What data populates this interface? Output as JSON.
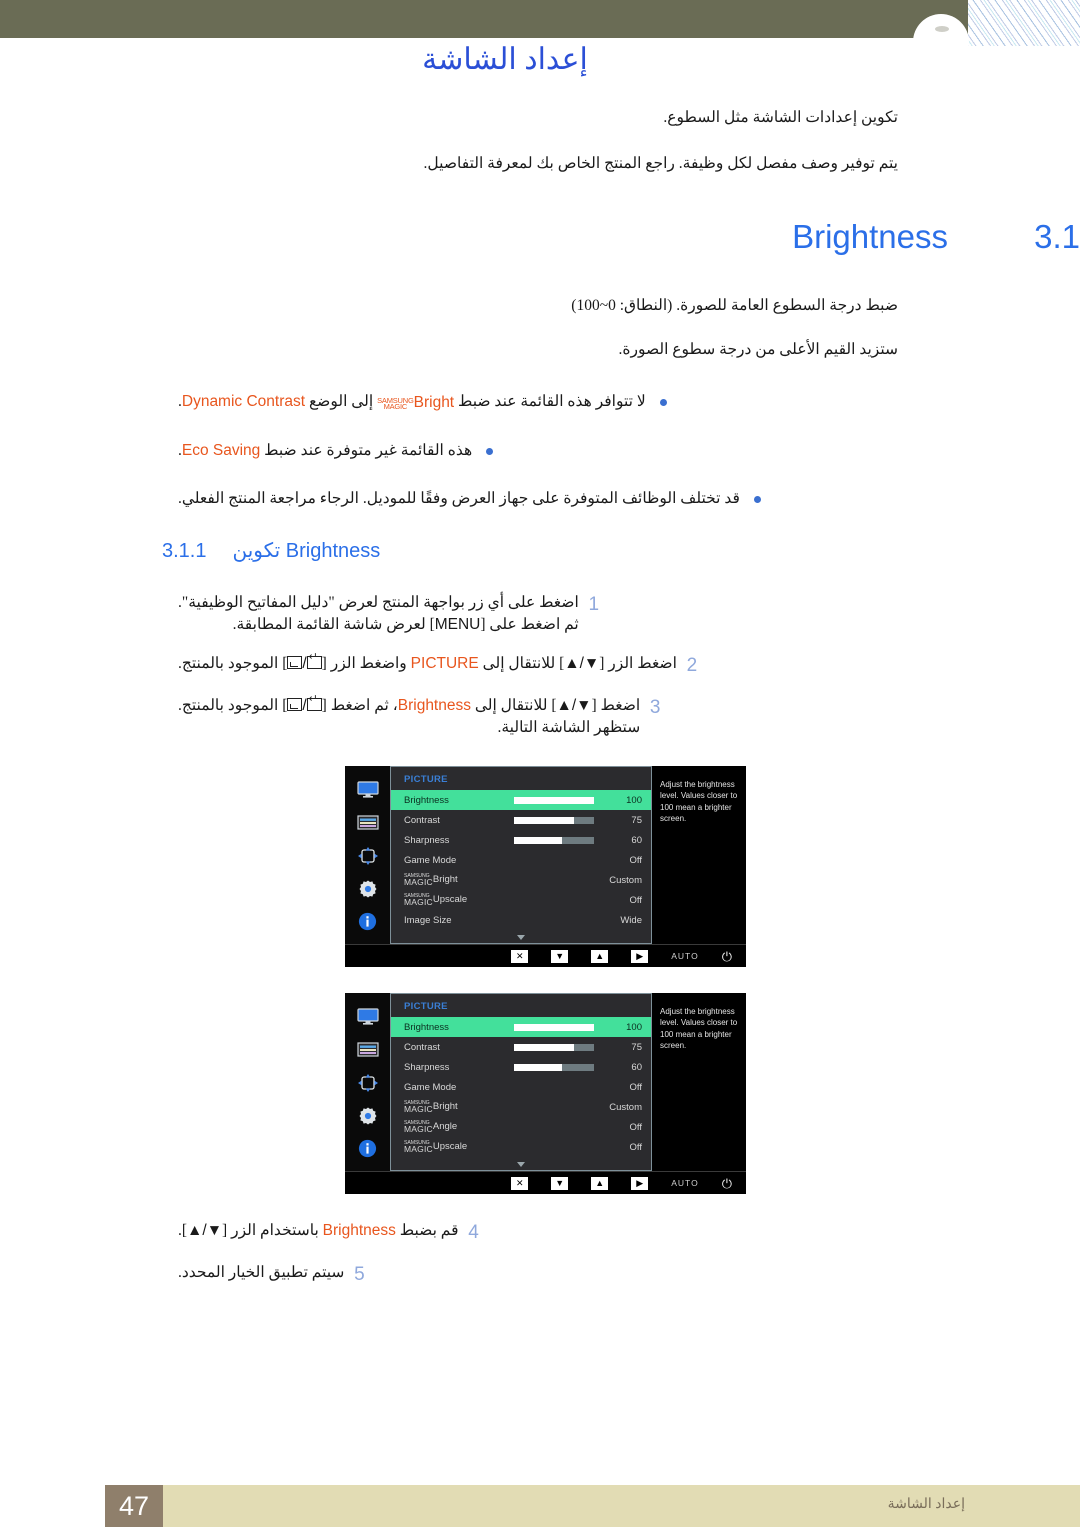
{
  "page": {
    "title": "إعداد الشاشة",
    "intro_1": "تكوين إعدادات الشاشة مثل السطوع.",
    "intro_2": "يتم توفير وصف مفصل لكل وظيفة. راجع المنتج الخاص بك لمعرفة التفاصيل."
  },
  "section": {
    "number": "3.1",
    "label": "Brightness",
    "desc_1": "ضبط درجة السطوع العامة للصورة. (النطاق: 0~100)",
    "desc_2": "ستزيد القيم الأعلى من درجة سطوع الصورة."
  },
  "bullets": [
    {
      "pre": "لا تتوافر هذه القائمة عند ضبط",
      "magic_line1": "SAMSUNG",
      "magic_line2": "MAGIC",
      "magic_suffix": "Bright",
      "mid": "إلى الوضع",
      "term": "Dynamic Contrast",
      "post": "."
    },
    {
      "pre": "هذه القائمة غير متوفرة عند ضبط",
      "term": "Eco Saving",
      "post": "."
    },
    {
      "pre": "قد تختلف الوظائف المتوفرة على جهاز العرض وفقًا للموديل. الرجاء مراجعة المنتج الفعلي."
    }
  ],
  "subsection": {
    "number": "3.1.1",
    "label_ar": "تكوين",
    "label_en": "Brightness"
  },
  "steps_top": [
    {
      "num": "1",
      "line1_a": "اضغط على أي زر بواجهة المنتج لعرض \"دليل المفاتيح الوظيفية\".",
      "line2_a": "ثم اضغط على [",
      "line2_key": "MENU",
      "line2_b": "] لعرض شاشة القائمة المطابقة."
    },
    {
      "num": "2",
      "line1_a": "اضغط الزر [",
      "key1": "▲/▼",
      "line1_b": "] للانتقال إلى",
      "term": "PICTURE",
      "line1_c": "واضغط الزر [",
      "line1_d": "] الموجود بالمنتج."
    },
    {
      "num": "3",
      "line1_a": "اضغط [",
      "key1": "▲/▼",
      "line1_b": "] للانتقال إلى",
      "term": "Brightness",
      "line1_c": "، ثم اضغط [",
      "line1_d": "] الموجود بالمنتج.",
      "line2": "ستظهر الشاشة التالية."
    }
  ],
  "steps_bottom": [
    {
      "num": "4",
      "line1_a": "قم بضبط",
      "term": "Brightness",
      "line1_b": "باستخدام الزر [",
      "key1": "▲/▼",
      "line1_c": "]."
    },
    {
      "num": "5",
      "line1_a": "سيتم تطبيق الخيار المحدد."
    }
  ],
  "osd": {
    "menu_title": "PICTURE",
    "help_text": "Adjust the brightness level. Values closer to 100 mean a brighter screen.",
    "sidebar_icons": [
      "monitor-icon",
      "menu-list-icon",
      "four-way-arrows-icon",
      "gear-icon",
      "info-icon"
    ],
    "bottom_bar": {
      "close": "✕",
      "down": "▼",
      "up": "▲",
      "right": "▶",
      "auto": "AUTO",
      "power": "⏻"
    },
    "screen1_rows": [
      {
        "label": "Brightness",
        "value": "100",
        "slider": 100,
        "selected": true
      },
      {
        "label": "Contrast",
        "value": "75",
        "slider": 75,
        "selected": false
      },
      {
        "label": "Sharpness",
        "value": "60",
        "slider": 60,
        "selected": false
      },
      {
        "label": "Game Mode",
        "value": "Off",
        "selected": false
      },
      {
        "label": "Bright",
        "magic": true,
        "magic_l1": "SAMSUNG",
        "magic_l2": "MAGIC",
        "value": "Custom",
        "selected": false
      },
      {
        "label": "Upscale",
        "magic": true,
        "magic_l1": "SAMSUNG",
        "magic_l2": "MAGIC",
        "value": "Off",
        "selected": false
      },
      {
        "label": "Image Size",
        "value": "Wide",
        "selected": false
      }
    ],
    "screen2_rows": [
      {
        "label": "Brightness",
        "value": "100",
        "slider": 100,
        "selected": true
      },
      {
        "label": "Contrast",
        "value": "75",
        "slider": 75,
        "selected": false
      },
      {
        "label": "Sharpness",
        "value": "60",
        "slider": 60,
        "selected": false
      },
      {
        "label": "Game Mode",
        "value": "Off",
        "selected": false
      },
      {
        "label": "Bright",
        "magic": true,
        "magic_l1": "SAMSUNG",
        "magic_l2": "MAGIC",
        "value": "Custom",
        "selected": false
      },
      {
        "label": "Angle",
        "magic": true,
        "magic_l1": "SAMSUNG",
        "magic_l2": "MAGIC",
        "value": "Off",
        "selected": false
      },
      {
        "label": "Upscale",
        "magic": true,
        "magic_l1": "SAMSUNG",
        "magic_l2": "MAGIC",
        "value": "Off",
        "selected": false
      }
    ]
  },
  "footer": {
    "page_number": "47",
    "chapter": "إعداد الشاشة"
  },
  "colors": {
    "header_band": "#6a6c55",
    "title_blue": "#2b4fd6",
    "heading_blue": "#2b6fe8",
    "term_orange": "#e8561e",
    "step_num": "#8fa8dc",
    "osd_highlight": "#43e09b",
    "footer_beige": "#e2dcb4",
    "footer_page_box": "#8f7f6b"
  }
}
